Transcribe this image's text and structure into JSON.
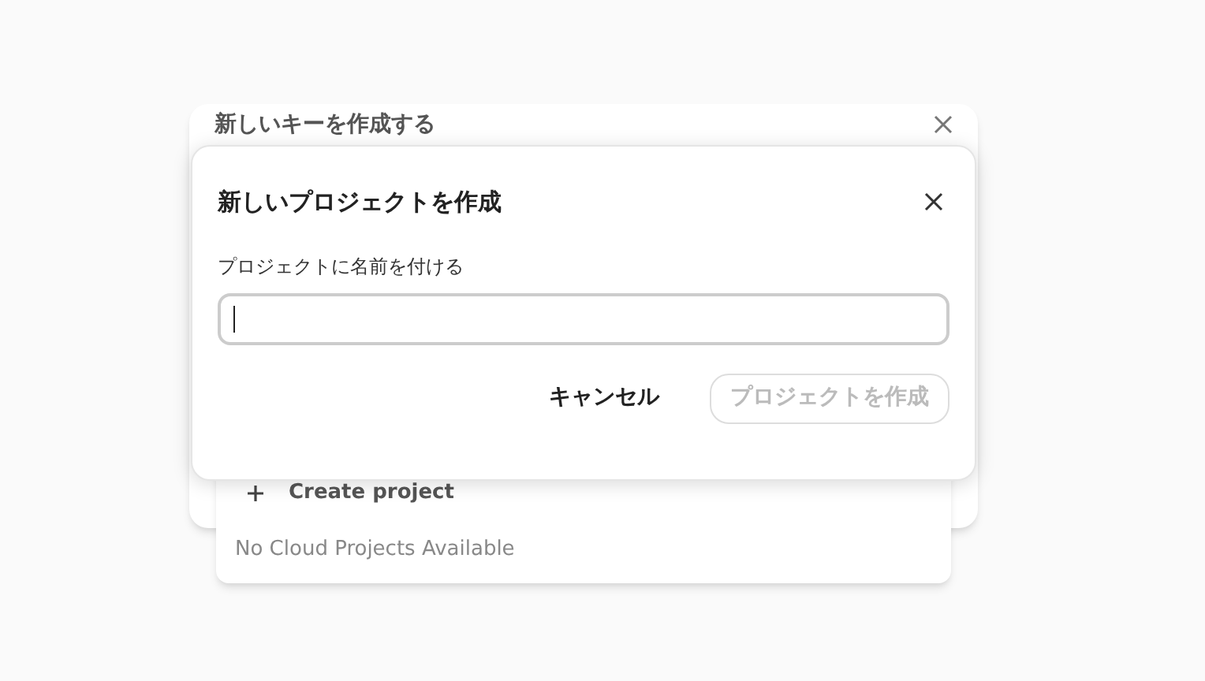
{
  "background_dialog": {
    "title": "新しいキーを作成する"
  },
  "background_menu": {
    "items": [
      {
        "kind": "action",
        "label": "Create project"
      },
      {
        "kind": "empty",
        "label": "No Cloud Projects Available"
      }
    ]
  },
  "dialog": {
    "title": "新しいプロジェクトを作成",
    "field_label": "プロジェクトに名前を付ける",
    "buttons": [
      {
        "label": "キャンセル",
        "kind": "text",
        "disabled": false
      },
      {
        "label": "プロジェクトを作成",
        "kind": "outline",
        "disabled": true
      }
    ]
  }
}
